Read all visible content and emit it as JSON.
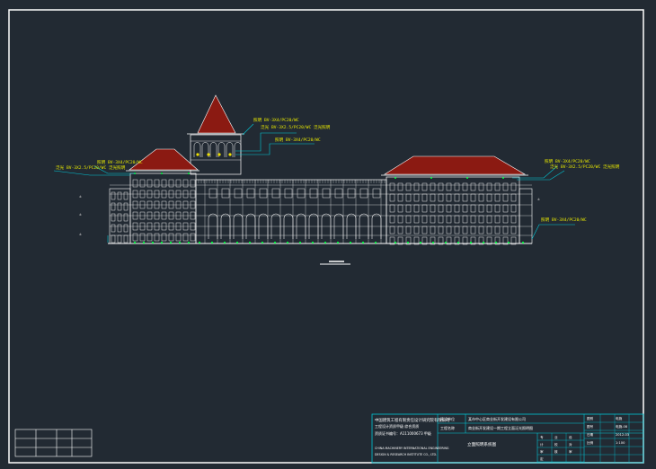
{
  "drawing": {
    "background": "#222a33",
    "line_color": "#ffffff",
    "roof_color": "#8b1a12",
    "annotation_color": "#e8e800",
    "leader_color": "#00c8d8",
    "lamp_color": "#00ff40"
  },
  "annotations": {
    "tower_top_1": "照明 BV-3X4/PC20/WC",
    "tower_top_2": "泛光 BV-3X2.5/PC20/WC 泛光照明",
    "tower_mid": "照明 BV-3X4/PC20/WC",
    "left_1": "照明 BV-3X4/PC20/WC",
    "left_2": "泛光 BV-3X2.5/PC20/WC 泛光照明",
    "right_1": "照明 BV-3X4/PC20/WC",
    "right_2": "泛光 BV-3X2.5/PC20/WC 泛光照明",
    "right_low": "照明 BV-3X4/PC20/WC",
    "elev_marks": [
      "±",
      "±",
      "±",
      "±"
    ]
  },
  "title_block": {
    "company_cn": "中国建筑工程有限责任设计研究院有限公司",
    "company_cn_2": "工程设计资质甲级 综合资质",
    "license": "资质证书编号：A111000673 甲级",
    "company_en_1": "CHINA MACHINERY INTERNATIONAL ENGINEERING",
    "company_en_2": "DESIGN & RESEARCH INSTITUTE CO., LTD.",
    "project_label": "建设单位",
    "project_value": "某市中心区商业街开发建设有限公司",
    "sub_label": "工程名称",
    "sub_value": "商业街开发建设一期工程立面泛光照明图",
    "drawing_title": "立面照明系统图",
    "cells_right": [
      "图别",
      "电施",
      "图号",
      "电施-08",
      "日期",
      "2012-03",
      "比例",
      "1:100"
    ],
    "bottom_row": [
      "专",
      "业",
      "设",
      "计",
      "校",
      "对",
      "审",
      "核",
      "审",
      "定"
    ]
  }
}
